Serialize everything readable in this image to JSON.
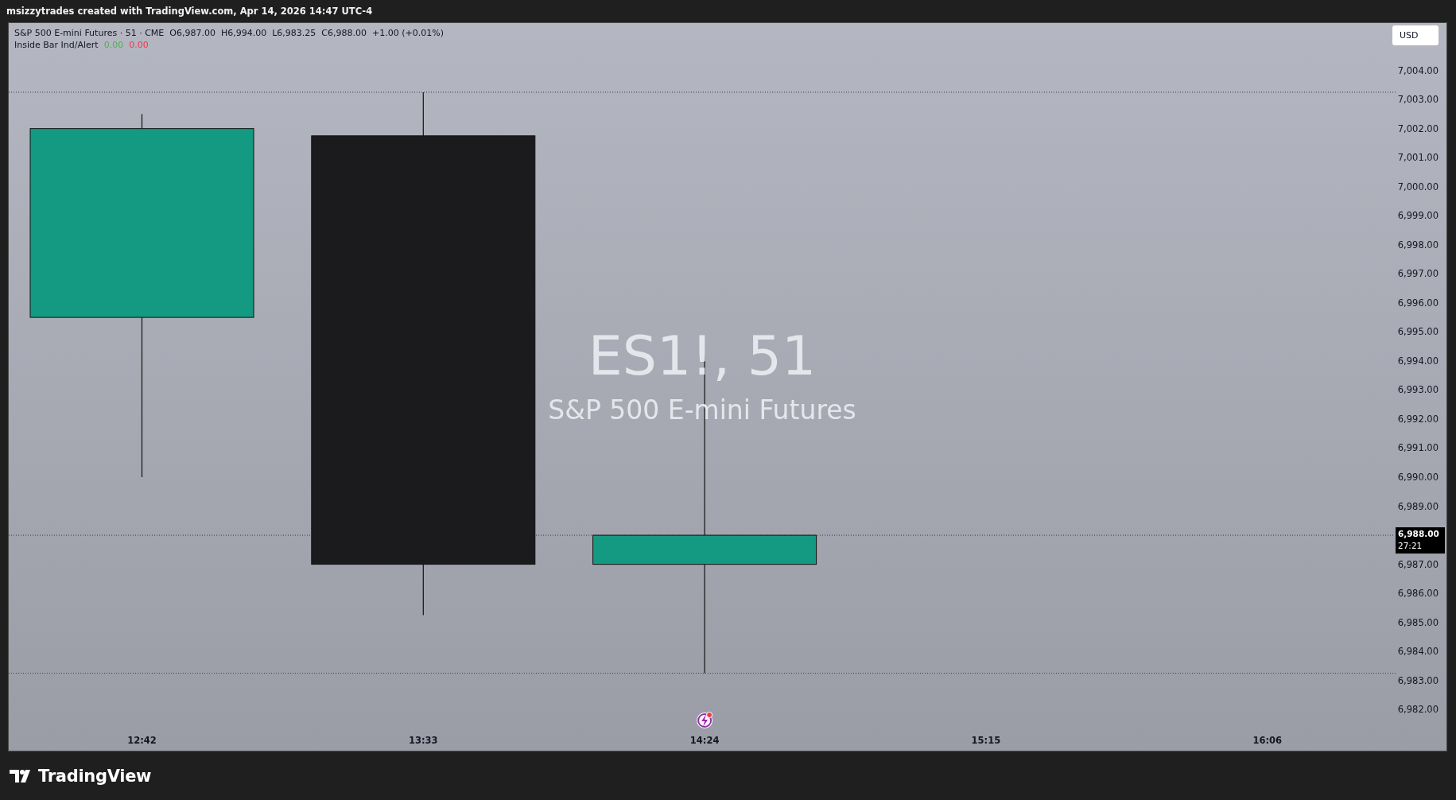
{
  "header": {
    "attribution": "msizzytrades created with TradingView.com, Apr 14, 2026 14:47 UTC-4"
  },
  "legend": {
    "symbol": "S&P 500 E-mini Futures · 51 · CME",
    "open": "O6,987.00",
    "high": "H6,994.00",
    "low": "L6,983.25",
    "close": "C6,988.00",
    "change": "+1.00 (+0.01%)"
  },
  "indicator": {
    "name": "Inside Bar Ind/Alert",
    "values": [
      {
        "text": "0.00",
        "color": "#4caf50"
      },
      {
        "text": "0.00",
        "color": "#f23645"
      }
    ]
  },
  "currency_button": "USD",
  "watermark": {
    "symbol": "ES1!, 51",
    "description": "S&P 500 E-mini Futures"
  },
  "price_axis": {
    "labels": [
      "7,004.00",
      "7,003.00",
      "7,002.00",
      "7,001.00",
      "7,000.00",
      "6,999.00",
      "6,998.00",
      "6,997.00",
      "6,996.00",
      "6,995.00",
      "6,994.00",
      "6,993.00",
      "6,992.00",
      "6,991.00",
      "6,990.00",
      "6,989.00",
      "6,987.00",
      "6,986.00",
      "6,985.00",
      "6,984.00",
      "6,983.00",
      "6,982.00"
    ]
  },
  "last_price": {
    "price": "6,988.00",
    "countdown": "27:21"
  },
  "time_axis": {
    "labels": [
      "12:42",
      "13:33",
      "14:24",
      "15:15",
      "16:06"
    ]
  },
  "footer": {
    "brand": "TradingView"
  }
}
